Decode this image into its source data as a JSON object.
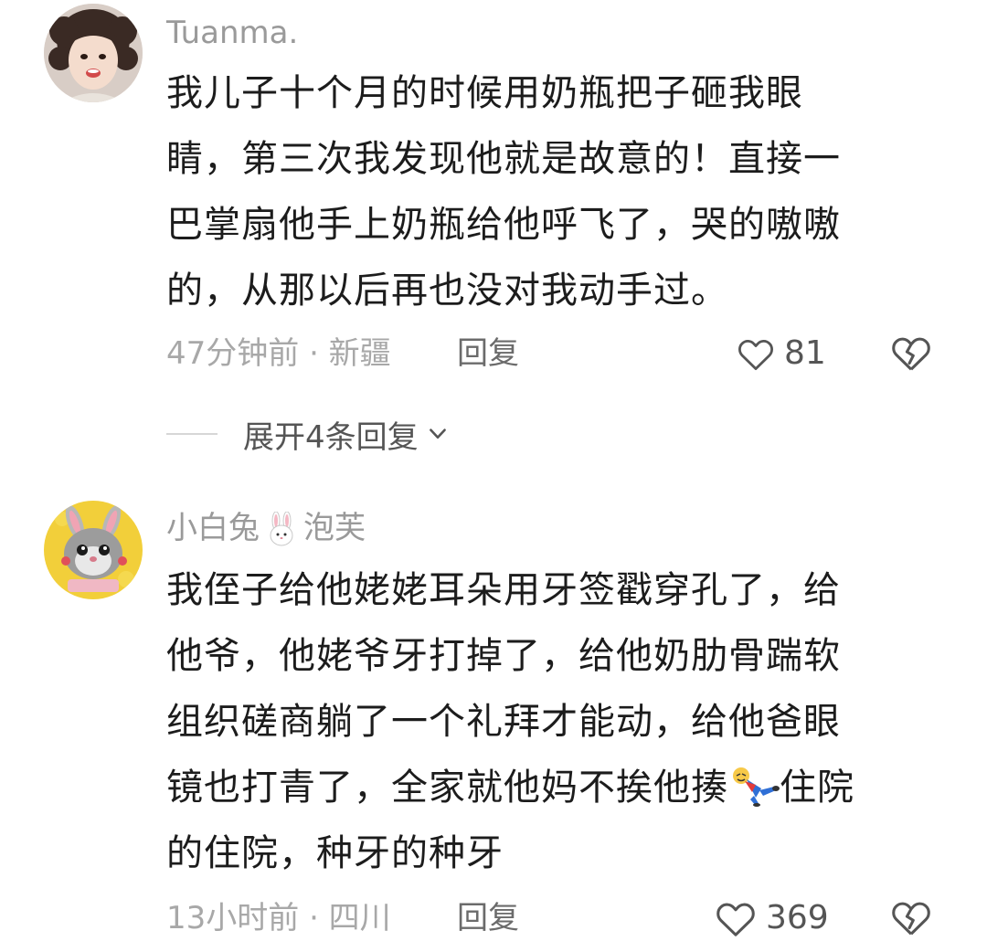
{
  "comments": [
    {
      "username": "Tuanma.",
      "lines": [
        "我儿子十个月的时候用奶瓶把子砸我眼",
        "睛，第三次我发现他就是故意的！直接一",
        "巴掌扇他手上奶瓶给他呼飞了，哭的嗷嗷",
        "的，从那以后再也没对我动手过。"
      ],
      "time_location": "47分钟前 · 新疆",
      "reply_label": "回复",
      "likes": "81",
      "expand_label": "展开4条回复"
    },
    {
      "username_part1": "小白兔",
      "username_emoji": "🐰",
      "username_part2": "泡芙",
      "lines": [
        "我侄子给他姥姥耳朵用牙签戳穿孔了，给",
        "他爷，他姥爷牙打掉了，给他奶肋骨踹软",
        "组织磋商躺了一个礼拜才能动，给他爸眼",
        "镜也打青了，全家就他妈不挨他揍",
        "住院",
        "的住院，种牙的种牙"
      ],
      "time_location": "13小时前 · 四川",
      "reply_label": "回复",
      "likes": "369"
    }
  ],
  "icons": {
    "like": "heart-outline-icon",
    "dislike": "broken-heart-icon",
    "expand": "chevron-down-icon",
    "inline_emoji": "fallen-person-emoji"
  },
  "colors": {
    "username": "#9a9a9a",
    "text": "#1c1c1c",
    "meta": "#a8a8a8",
    "reply": "#6b6b6b"
  }
}
